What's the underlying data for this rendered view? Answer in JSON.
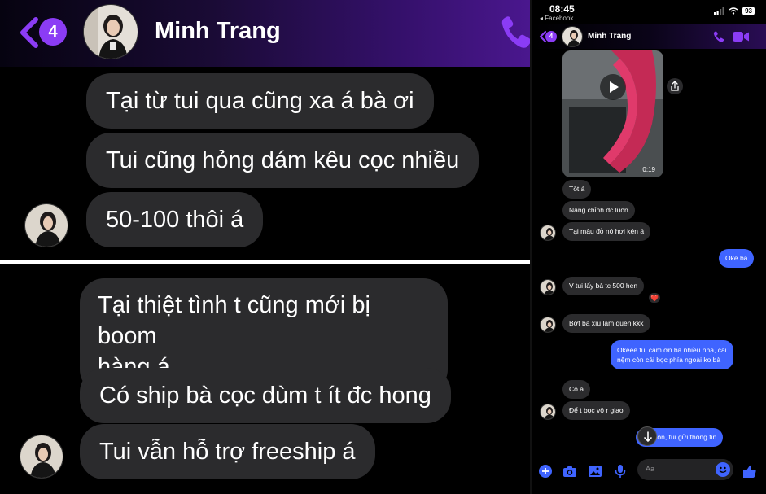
{
  "colors": {
    "accent": "#8b3cf5",
    "incoming_bubble": "#2b2b2d",
    "outgoing_bubble": "#3f64ff",
    "background": "#000000",
    "reaction_heart": "#ff3333"
  },
  "zoom_header": {
    "back_icon": "chevron-left-icon",
    "unread_count": "4",
    "contact_name": "Minh Trang",
    "call_icon": "phone-icon"
  },
  "zoom_top_messages": [
    {
      "text": "Tại từ tui qua cũng xa á bà ơi"
    },
    {
      "text": "Tui cũng hỏng dám kêu cọc nhiều"
    },
    {
      "text": "50-100 thôi á"
    }
  ],
  "zoom_bottom_messages": [
    {
      "line1": "Tại thiệt tình t cũng mới bị boom",
      "line2": "hàng á"
    },
    {
      "text": "Có ship bà cọc dùm t ít đc hong"
    },
    {
      "text": "Tui vẫn hỗ trợ freeship á"
    }
  ],
  "status_bar": {
    "time": "08:45",
    "back_to_app": "◂ Facebook",
    "battery": "93"
  },
  "phone_header": {
    "unread_count": "4",
    "contact_name": "Minh Trang"
  },
  "video": {
    "duration": "0:19"
  },
  "messages": [
    {
      "id": "m1",
      "text": "Tốt á"
    },
    {
      "id": "m2",
      "text": "Nâng chỉnh đc luôn"
    },
    {
      "id": "m3",
      "text": "Tại màu đỏ nó hơi kén á"
    },
    {
      "id": "m4",
      "text": "Oke bà"
    },
    {
      "id": "m5",
      "text": "V tui lấy bà tc 500 hen",
      "reaction": "❤️"
    },
    {
      "id": "m6",
      "text": "Bớt bà xíu làm quen kkk"
    },
    {
      "id": "m7",
      "line1": "Okeee tui cảm ơn bà nhiều nha, cái",
      "line2": "nệm còn cái bọc phía ngoài ko bà"
    },
    {
      "id": "m8",
      "text": "Có á"
    },
    {
      "id": "m9",
      "text": "Để t bọc vô r giao"
    },
    {
      "id": "m10",
      "text": "bà luôn, tui gửi thông tin"
    }
  ],
  "composer": {
    "placeholder": "Aa"
  }
}
